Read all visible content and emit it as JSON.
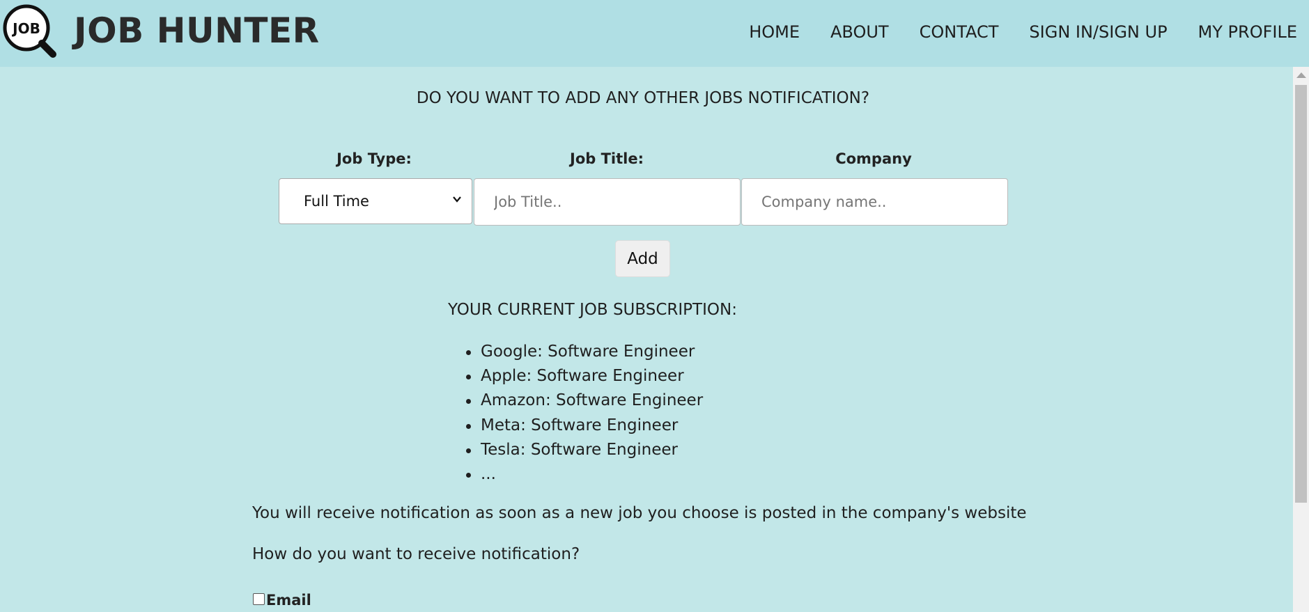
{
  "header": {
    "logo_text": "JOB",
    "brand": "JOB HUNTER",
    "nav": [
      "HOME",
      "ABOUT",
      "CONTACT",
      "SIGN IN/SIGN UP",
      "MY PROFILE"
    ]
  },
  "form": {
    "question": "DO YOU WANT TO ADD ANY OTHER JOBS NOTIFICATION?",
    "job_type_label": "Job Type:",
    "job_title_label": "Job Title:",
    "company_label": "Company",
    "job_type_value": "Full Time",
    "job_title_placeholder": "Job Title..",
    "company_placeholder": "Company name..",
    "add_label": "Add"
  },
  "subscriptions": {
    "heading": "YOUR CURRENT JOB SUBSCRIPTION:",
    "items": [
      "Google: Software Engineer",
      "Apple: Software Engineer",
      "Amazon: Software Engineer",
      "Meta: Software Engineer",
      "Tesla: Software Engineer",
      "..."
    ]
  },
  "notification": {
    "info": "You will receive notification as soon as a new job you choose is posted in the company's website",
    "question": "How do you want to receive notification?",
    "email_label": "Email",
    "email_checked": false
  },
  "colors": {
    "header_bg": "#b0dfe4",
    "page_bg": "#c2e7e8"
  }
}
